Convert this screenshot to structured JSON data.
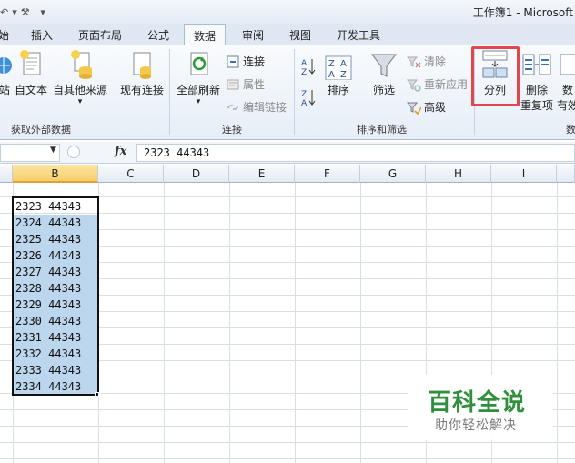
{
  "window": {
    "title": "工作簿1 - Microsoft"
  },
  "tabs": [
    {
      "label": "始",
      "active": false
    },
    {
      "label": "插入",
      "active": false
    },
    {
      "label": "页面布局",
      "active": false
    },
    {
      "label": "公式",
      "active": false
    },
    {
      "label": "数据",
      "active": true
    },
    {
      "label": "审阅",
      "active": false
    },
    {
      "label": "视图",
      "active": false
    },
    {
      "label": "开发工具",
      "active": false
    }
  ],
  "ribbon": {
    "external_data": {
      "group_label": "获取外部数据",
      "from_web": "站",
      "from_text": "自文本",
      "from_other": "自其他来源",
      "existing": "现有连接"
    },
    "connections": {
      "group_label": "连接",
      "refresh_all": "全部刷新",
      "connections": "连接",
      "properties": "属性",
      "edit_links": "编辑链接"
    },
    "sort_filter": {
      "group_label": "排序和筛选",
      "sort": "排序",
      "filter": "筛选",
      "clear": "清除",
      "reapply": "重新应用",
      "advanced": "高级",
      "az": "A Z",
      "za": "Z A"
    },
    "data_tools": {
      "group_label": "数",
      "text_to_columns": "分列",
      "remove_duplicates_1": "删除",
      "remove_duplicates_2": "重复项",
      "validation_1": "数",
      "validation_2": "有效"
    },
    "highlight_color": "#e2474d"
  },
  "formula_bar": {
    "fx": "fx",
    "value": "2323 44343"
  },
  "columns": [
    "B",
    "C",
    "D",
    "E",
    "F",
    "G",
    "H",
    "I"
  ],
  "selected_column": "B",
  "cells": [
    "2323 44343",
    "2324 44343",
    "2325 44343",
    "2326 44343",
    "2327 44343",
    "2328 44343",
    "2329 44343",
    "2330 44343",
    "2331 44343",
    "2332 44343",
    "2333 44343",
    "2334 44343"
  ],
  "watermark": {
    "title": "百科全说",
    "subtitle": "助你轻松解决"
  }
}
